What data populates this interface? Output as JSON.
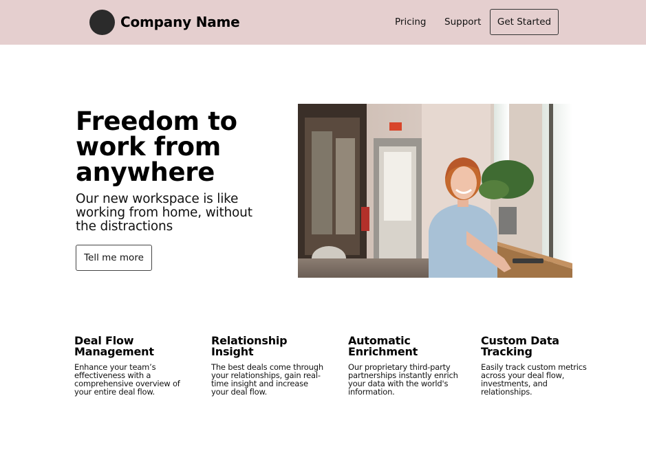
{
  "header": {
    "company_name": "Company Name",
    "nav": {
      "pricing": "Pricing",
      "support": "Support",
      "get_started": "Get Started"
    },
    "background_color": "#e5cfcf"
  },
  "hero": {
    "title": "Freedom to work from anywhere",
    "subtitle": "Our new workspace is like working from home, without the distractions",
    "cta": "Tell me more",
    "image": "woman smiling at window desk in bright cafe workspace"
  },
  "features": [
    {
      "title": "Deal Flow Management",
      "description": "Enhance your team’s effectiveness with a comprehensive overview of your entire deal flow."
    },
    {
      "title": "Relationship Insight",
      "description": "The best deals come through your relationships, gain real-time insight and increase your deal flow."
    },
    {
      "title": "Automatic Enrichment",
      "description": "Our proprietary third-party partnerships instantly enrich your data with the world's information."
    },
    {
      "title": "Custom Data Tracking",
      "description": "Easily track custom metrics across your deal flow, investments, and relationships."
    }
  ]
}
